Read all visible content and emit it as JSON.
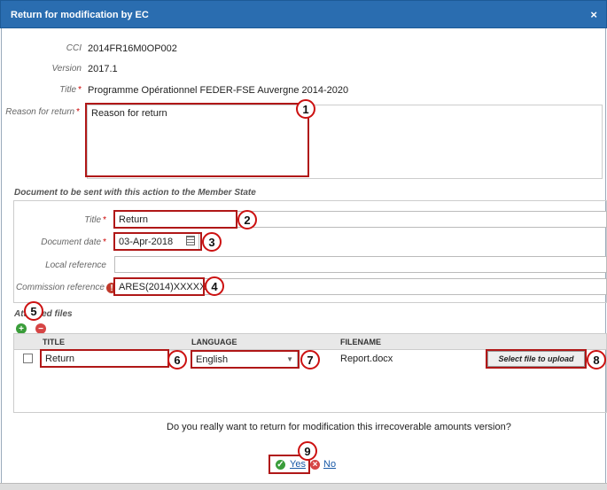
{
  "dialog": {
    "title": "Return for modification by EC",
    "close_symbol": "×"
  },
  "fields": {
    "cci_label": "CCI",
    "cci_value": "2014FR16M0OP002",
    "version_label": "Version",
    "version_value": "2017.1",
    "title_label": "Title",
    "title_value": "Programme Opérationnel FEDER-FSE Auvergne 2014-2020",
    "reason_label": "Reason for return",
    "reason_value": "Reason for return"
  },
  "document": {
    "section_label": "Document to be sent with this action to the Member State",
    "title_label": "Title",
    "title_value": "Return",
    "date_label": "Document date",
    "date_value": "03-Apr-2018",
    "local_ref_label": "Local reference",
    "local_ref_value": "",
    "commission_ref_label": "Commission reference",
    "commission_ref_value": "ARES(2014)XXXXX"
  },
  "attached": {
    "section_label": "Attached files",
    "columns": [
      "TITLE",
      "LANGUAGE",
      "FILENAME"
    ],
    "row": {
      "title": "Return",
      "language": "English",
      "filename": "Report.docx",
      "upload_label": "Select file to upload"
    }
  },
  "confirm": {
    "question": "Do you really want to return for modification this irrecoverable amounts version?",
    "yes": "Yes",
    "no": "No"
  },
  "callouts": [
    "1",
    "2",
    "3",
    "4",
    "5",
    "6",
    "7",
    "8",
    "9"
  ],
  "colors": {
    "titlebar": "#2a6db0",
    "callout_border": "#cc1111",
    "highlight_border": "#b01717"
  }
}
